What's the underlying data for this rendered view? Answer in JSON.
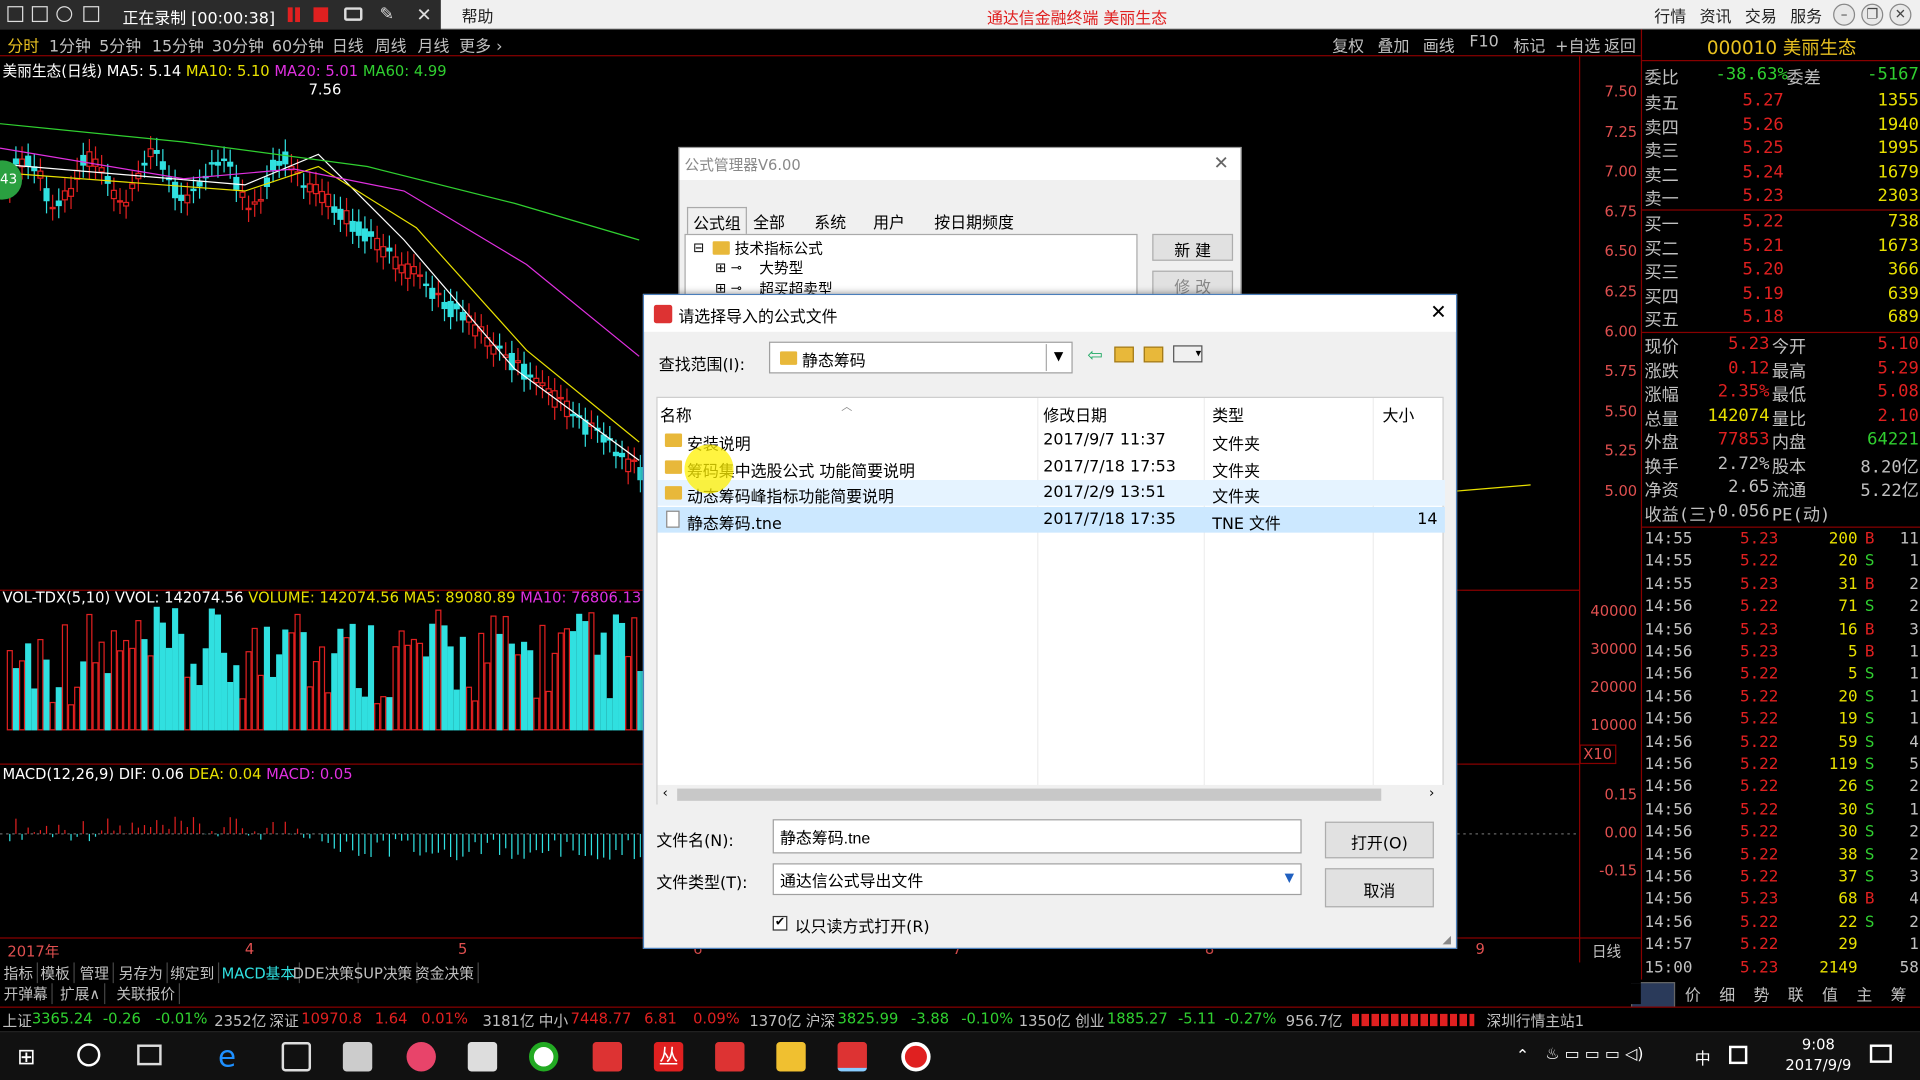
{
  "titlebar": {
    "recording": "正在录制 [00:00:38]",
    "help": "帮助",
    "center_title": "通达信金融终端  美丽生态",
    "menu": [
      "行情",
      "资讯",
      "交易",
      "服务"
    ]
  },
  "period_bar": {
    "items": [
      "分时",
      "1分钟",
      "5分钟",
      "15分钟",
      "30分钟",
      "60分钟",
      "日线",
      "周线",
      "月线",
      "更多 ›"
    ],
    "tools": [
      "复权",
      "叠加",
      "画线",
      "F10",
      "标记",
      "+自选",
      "返回"
    ]
  },
  "main_legend": {
    "name": "美丽生态(日线)",
    "ma5": "MA5: 5.14",
    "ma10": "MA10: 5.10",
    "ma20": "MA20: 5.01",
    "ma60": "MA60: 4.99",
    "high_label": "7.56"
  },
  "price_scale": [
    "7.50",
    "7.25",
    "7.00",
    "6.75",
    "6.50",
    "6.25",
    "6.00",
    "5.75",
    "5.50",
    "5.25",
    "5.00"
  ],
  "vol_legend": {
    "name": "VOL-TDX(5,10)",
    "vvol": "VVOL: 142074.56",
    "volume": "VOLUME: 142074.56",
    "ma5": "MA5: 89080.89",
    "ma10": "MA10: 76806.13"
  },
  "vol_scale": [
    "40000",
    "30000",
    "20000",
    "10000"
  ],
  "vol_unit": "X10",
  "macd_legend": {
    "name": "MACD(12,26,9)",
    "dif": "DIF: 0.06",
    "dea": "DEA: 0.04",
    "macd": "MACD: 0.05"
  },
  "macd_scale": [
    "0.15",
    "0.00",
    "-0.15"
  ],
  "date_axis": [
    "2017年",
    "4",
    "5",
    "6",
    "7",
    "8",
    "9"
  ],
  "axis_mode": "日线",
  "badge": "43",
  "quote": {
    "code": "000010",
    "name": "美丽生态",
    "weibi_label": "委比",
    "weibi": "-38.63%",
    "weicha_label": "委差",
    "weicha": "-5167",
    "sells": [
      {
        "label": "卖五",
        "price": "5.27",
        "vol": "1355"
      },
      {
        "label": "卖四",
        "price": "5.26",
        "vol": "1940"
      },
      {
        "label": "卖三",
        "price": "5.25",
        "vol": "1995"
      },
      {
        "label": "卖二",
        "price": "5.24",
        "vol": "1679"
      },
      {
        "label": "卖一",
        "price": "5.23",
        "vol": "2303"
      }
    ],
    "buys": [
      {
        "label": "买一",
        "price": "5.22",
        "vol": "738"
      },
      {
        "label": "买二",
        "price": "5.21",
        "vol": "1673"
      },
      {
        "label": "买三",
        "price": "5.20",
        "vol": "366"
      },
      {
        "label": "买四",
        "price": "5.19",
        "vol": "639"
      },
      {
        "label": "买五",
        "price": "5.18",
        "vol": "689"
      }
    ],
    "stats": [
      {
        "l1": "现价",
        "v1": "5.23",
        "l2": "今开",
        "v2": "5.10"
      },
      {
        "l1": "涨跌",
        "v1": "0.12",
        "l2": "最高",
        "v2": "5.29"
      },
      {
        "l1": "涨幅",
        "v1": "2.35%",
        "l2": "最低",
        "v2": "5.08"
      },
      {
        "l1": "总量",
        "v1": "142074",
        "l2": "量比",
        "v2": "2.10"
      },
      {
        "l1": "外盘",
        "v1": "77853",
        "l2": "内盘",
        "v2": "64221"
      },
      {
        "l1": "换手",
        "v1": "2.72%",
        "l2": "股本",
        "v2": "8.20亿"
      },
      {
        "l1": "净资",
        "v1": "2.65",
        "l2": "流通",
        "v2": "5.22亿"
      },
      {
        "l1": "收益(三)",
        "v1": "-0.056",
        "l2": "PE(动)",
        "v2": ""
      }
    ],
    "ticks": [
      {
        "t": "14:55",
        "p": "5.23",
        "v": "200",
        "bs": "B",
        "n": "11"
      },
      {
        "t": "14:55",
        "p": "5.22",
        "v": "20",
        "bs": "S",
        "n": "1"
      },
      {
        "t": "14:55",
        "p": "5.23",
        "v": "31",
        "bs": "B",
        "n": "2"
      },
      {
        "t": "14:56",
        "p": "5.22",
        "v": "71",
        "bs": "S",
        "n": "2"
      },
      {
        "t": "14:56",
        "p": "5.23",
        "v": "16",
        "bs": "B",
        "n": "3"
      },
      {
        "t": "14:56",
        "p": "5.23",
        "v": "5",
        "bs": "B",
        "n": "1"
      },
      {
        "t": "14:56",
        "p": "5.22",
        "v": "5",
        "bs": "S",
        "n": "1"
      },
      {
        "t": "14:56",
        "p": "5.22",
        "v": "20",
        "bs": "S",
        "n": "1"
      },
      {
        "t": "14:56",
        "p": "5.22",
        "v": "19",
        "bs": "S",
        "n": "1"
      },
      {
        "t": "14:56",
        "p": "5.22",
        "v": "59",
        "bs": "S",
        "n": "4"
      },
      {
        "t": "14:56",
        "p": "5.22",
        "v": "119",
        "bs": "S",
        "n": "5"
      },
      {
        "t": "14:56",
        "p": "5.22",
        "v": "26",
        "bs": "S",
        "n": "2"
      },
      {
        "t": "14:56",
        "p": "5.22",
        "v": "30",
        "bs": "S",
        "n": "1"
      },
      {
        "t": "14:56",
        "p": "5.22",
        "v": "30",
        "bs": "S",
        "n": "2"
      },
      {
        "t": "14:56",
        "p": "5.22",
        "v": "38",
        "bs": "S",
        "n": "2"
      },
      {
        "t": "14:56",
        "p": "5.22",
        "v": "37",
        "bs": "S",
        "n": "3"
      },
      {
        "t": "14:56",
        "p": "5.23",
        "v": "68",
        "bs": "B",
        "n": "4"
      },
      {
        "t": "14:56",
        "p": "5.22",
        "v": "22",
        "bs": "S",
        "n": "2"
      },
      {
        "t": "14:57",
        "p": "5.22",
        "v": "29",
        "bs": "",
        "n": "1"
      },
      {
        "t": "15:00",
        "p": "5.23",
        "v": "2149",
        "bs": "",
        "n": "58"
      }
    ],
    "bottom_tabs": [
      "价",
      "细",
      "势",
      "联",
      "值",
      "主",
      "筹"
    ]
  },
  "bottom_tabs": [
    "指标",
    "模板",
    "管理",
    "另存为",
    "绑定到",
    "MACD基本",
    "DDE决策",
    "SUP决策",
    "资金决策"
  ],
  "sub_tabs": [
    "开弹幕",
    "扩展∧",
    "关联报价"
  ],
  "ticker": {
    "sh_label": "上证",
    "sh": "3365.24",
    "sh_chg": "-0.26",
    "sh_pct": "-0.01%",
    "sh_amt": "2352亿",
    "sz_label": "深证",
    "sz": "10970.8",
    "sz_chg": "1.64",
    "sz_pct": "0.01%",
    "sz_amt": "3181亿",
    "zx_label": "中小",
    "zx": "7448.77",
    "zx_chg": "6.81",
    "zx_pct": "0.09%",
    "zx_amt": "1370亿",
    "hs_label": "沪深",
    "hs": "3825.99",
    "hs_chg": "-3.88",
    "hs_pct": "-0.10%",
    "hs_amt": "1350亿",
    "cy_label": "创业",
    "cy": "1885.27",
    "cy_chg": "-5.11",
    "cy_pct": "-0.27%",
    "cy_amt": "956.7亿",
    "server": "深圳行情主站1"
  },
  "taskbar": {
    "time": "9:08",
    "date": "2017/9/9",
    "ime": "中"
  },
  "formula_manager": {
    "title": "公式管理器V6.00",
    "tabs": [
      "公式组",
      "全部",
      "系统",
      "用户",
      "按日期频度"
    ],
    "tree_root": "技术指标公式",
    "tree_items": [
      "大势型",
      "超买超卖型"
    ],
    "btn_new": "新  建",
    "btn_modify": "修  改"
  },
  "open_dialog": {
    "title": "请选择导入的公式文件",
    "lookin_label": "查找范围(I):",
    "lookin_value": "静态筹码",
    "columns": [
      "名称",
      "修改日期",
      "类型",
      "大小"
    ],
    "files": [
      {
        "name": "安装说明",
        "date": "2017/9/7 11:37",
        "type": "文件夹",
        "size": "",
        "kind": "folder"
      },
      {
        "name": "筹码集中选股公式 功能简要说明",
        "date": "2017/7/18 17:53",
        "type": "文件夹",
        "size": "",
        "kind": "folder"
      },
      {
        "name": "动态筹码峰指标功能简要说明",
        "date": "2017/2/9 13:51",
        "type": "文件夹",
        "size": "",
        "kind": "folder"
      },
      {
        "name": "静态筹码.tne",
        "date": "2017/7/18 17:35",
        "type": "TNE 文件",
        "size": "14",
        "kind": "file"
      }
    ],
    "filename_label": "文件名(N):",
    "filename_value": "静态筹码.tne",
    "filetype_label": "文件类型(T):",
    "filetype_value": "通达信公式导出文件",
    "readonly_label": "以只读方式打开(R)",
    "btn_open": "打开(O)",
    "btn_cancel": "取消"
  }
}
